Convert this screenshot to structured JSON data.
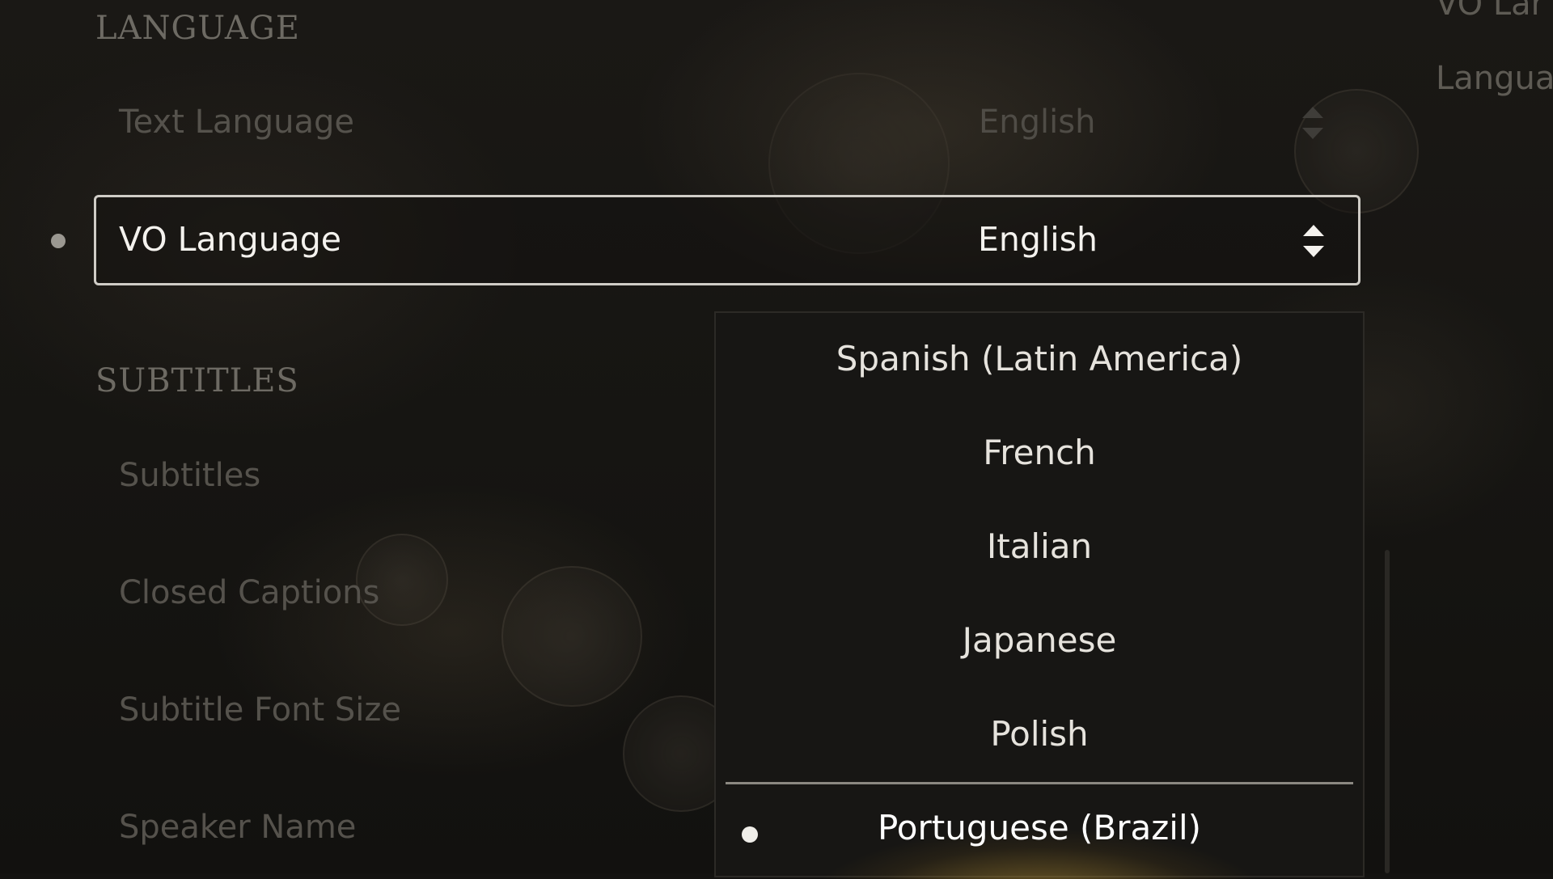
{
  "sections": {
    "language_header": "LANGUAGE",
    "subtitles_header": "SUBTITLES"
  },
  "rows": {
    "text_language_label": "Text Language",
    "text_language_value": "English",
    "vo_language_label": "VO Language",
    "vo_language_value": "English",
    "subtitles_label": "Subtitles",
    "closed_captions_label": "Closed Captions",
    "subtitle_font_size_label": "Subtitle Font Size",
    "speaker_name_label": "Speaker Name"
  },
  "right_panel": {
    "line1": "VO Lar",
    "line2": "Langua"
  },
  "dropdown": {
    "options": [
      "Spanish (Latin America)",
      "French",
      "Italian",
      "Japanese",
      "Polish",
      "Portuguese (Brazil)"
    ],
    "highlighted_option": "Portuguese (Brazil)"
  },
  "icons": {
    "selector_arrows": "up-down-arrows-icon",
    "selection_dot": "bullet-icon"
  }
}
